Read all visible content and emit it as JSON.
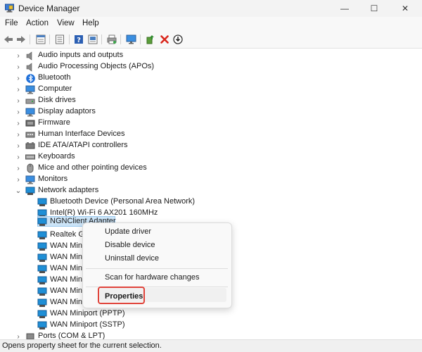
{
  "window": {
    "title": "Device Manager",
    "icon": "device-manager-icon",
    "controls": [
      "minimize-icon",
      "maximize-icon",
      "close-icon"
    ]
  },
  "menu": [
    "File",
    "Action",
    "View",
    "Help"
  ],
  "toolbar": {
    "icons": [
      "back-arrow-icon",
      "forward-arrow-icon",
      "properties-sheet-icon",
      "list-view-icon",
      "help-icon",
      "device-view-icon",
      "print-icon",
      "monitor-icon",
      "add-driver-icon",
      "uninstall-x-icon",
      "download-icon"
    ]
  },
  "tree": {
    "categories": [
      {
        "label": "Audio inputs and outputs",
        "icon": "speaker-icon",
        "expanded": false
      },
      {
        "label": "Audio Processing Objects (APOs)",
        "icon": "speaker-icon",
        "expanded": false
      },
      {
        "label": "Bluetooth",
        "icon": "bluetooth-icon",
        "expanded": false
      },
      {
        "label": "Computer",
        "icon": "computer-icon",
        "expanded": false
      },
      {
        "label": "Disk drives",
        "icon": "disk-drive-icon",
        "expanded": false
      },
      {
        "label": "Display adaptors",
        "icon": "display-adapter-icon",
        "expanded": false
      },
      {
        "label": "Firmware",
        "icon": "firmware-icon",
        "expanded": false
      },
      {
        "label": "Human Interface Devices",
        "icon": "hid-icon",
        "expanded": false
      },
      {
        "label": "IDE ATA/ATAPI controllers",
        "icon": "ide-controller-icon",
        "expanded": false
      },
      {
        "label": "Keyboards",
        "icon": "keyboard-icon",
        "expanded": false
      },
      {
        "label": "Mice and other pointing devices",
        "icon": "mouse-icon",
        "expanded": false
      },
      {
        "label": "Monitors",
        "icon": "monitor-icon",
        "expanded": false
      },
      {
        "label": "Network adapters",
        "icon": "network-adapter-icon",
        "expanded": true
      }
    ],
    "network_children": [
      "Bluetooth Device (Personal Area Network)",
      "Intel(R) Wi-Fi 6 AX201 160MHz",
      "NGNClient Adapter",
      "Realtek Ga",
      "WAN Min",
      "WAN Min",
      "WAN Min",
      "WAN Min",
      "WAN Min",
      "WAN Min",
      "WAN Miniport (PPTP)",
      "WAN Miniport (SSTP)"
    ],
    "after": {
      "label": "Ports (COM & LPT)",
      "icon": "port-icon",
      "expanded": false
    }
  },
  "context_menu": {
    "items": [
      "Update driver",
      "Disable device",
      "Uninstall device",
      "Scan for hardware changes",
      "Properties"
    ],
    "highlighted": "Properties",
    "highlight_color": "#e0433a"
  },
  "status": {
    "text": "Opens property sheet for the current selection."
  },
  "colors": {
    "selection": "#cce4f7",
    "selection_border": "#99c9ef",
    "network_icon": "#1f8fd6"
  }
}
